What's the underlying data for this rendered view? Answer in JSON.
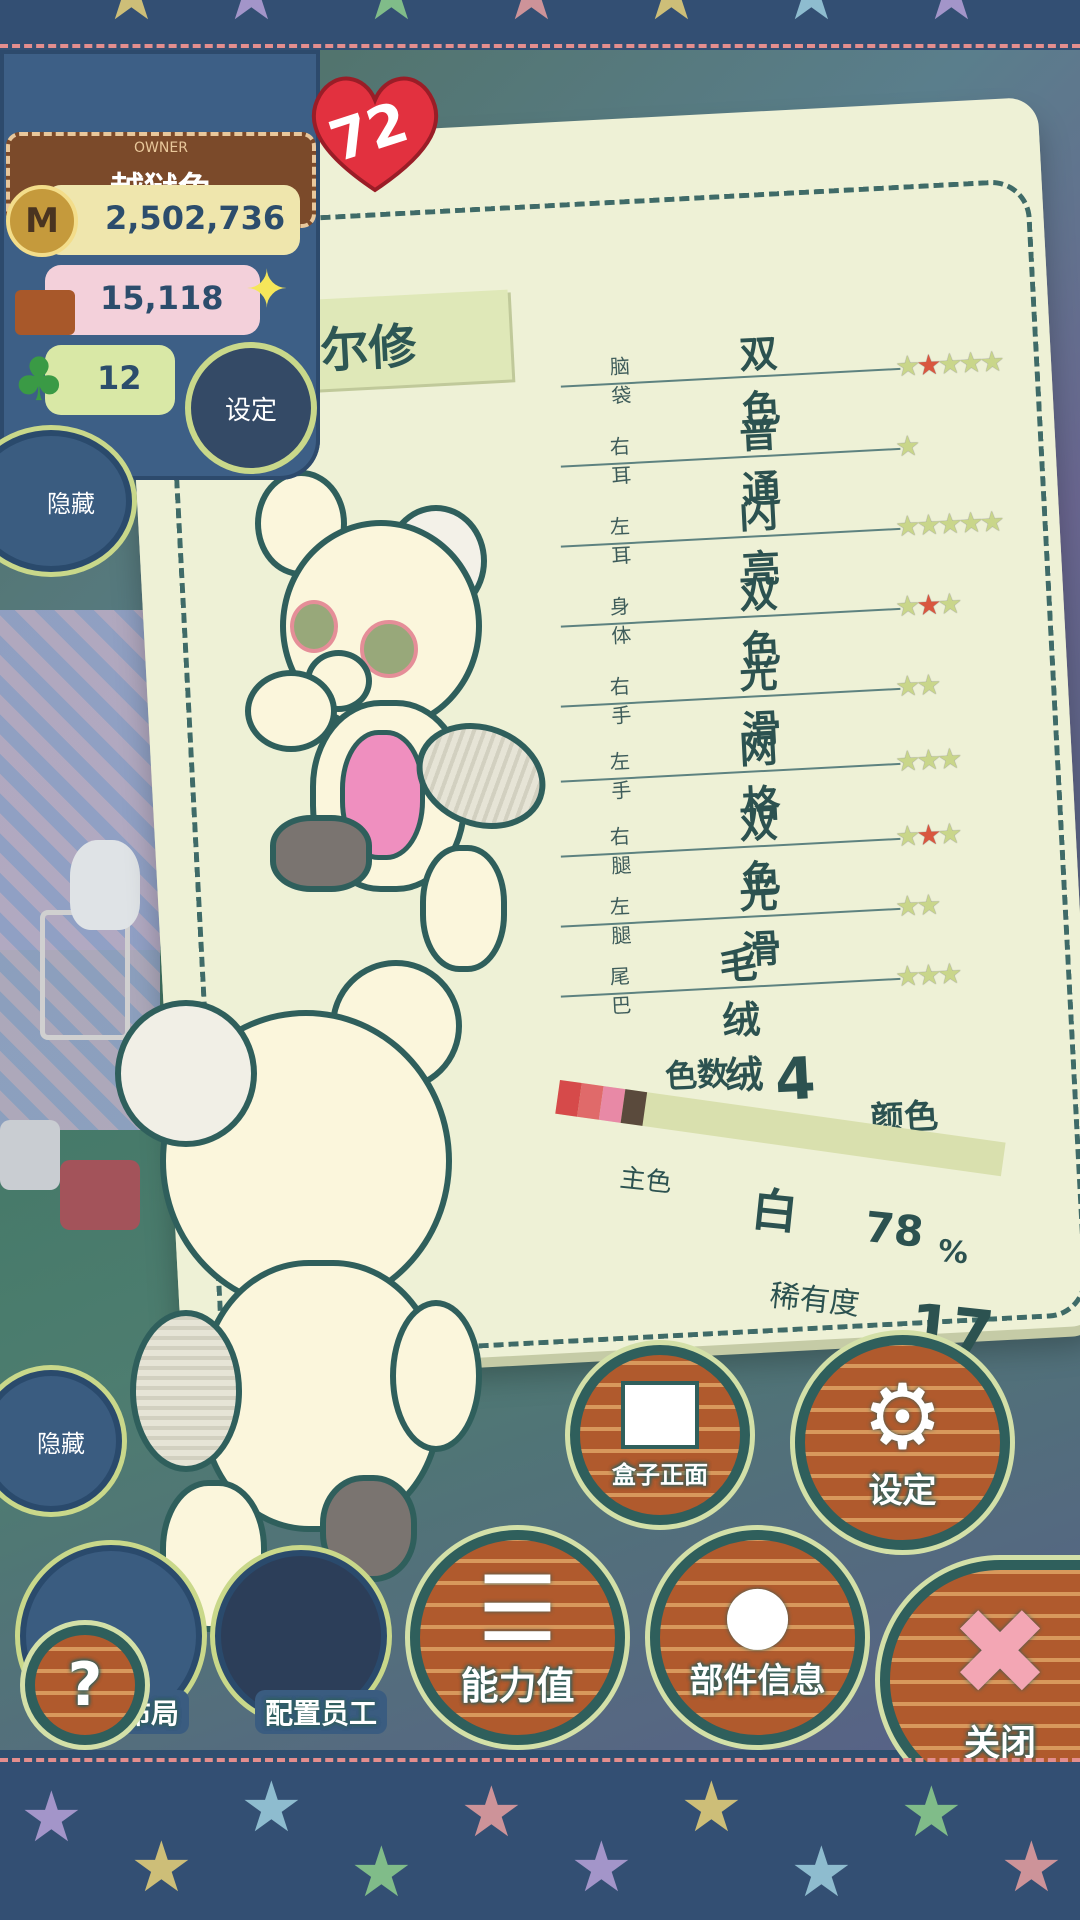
{
  "owner": {
    "caption": "OWNER",
    "name": "越狱兔",
    "money": "2,502,736",
    "money_icon": "M",
    "items": "15,118",
    "clover": "12",
    "settings_label": "设定"
  },
  "heart_level": "72",
  "hide_label": "隐藏",
  "bear_name": "尔修",
  "parts": [
    {
      "label": "脑袋",
      "value": "双色",
      "stars": 5,
      "highlight": 2
    },
    {
      "label": "右耳",
      "value": "普通",
      "stars": 1,
      "highlight": 0
    },
    {
      "label": "左耳",
      "value": "闪亮",
      "stars": 5,
      "highlight": 0
    },
    {
      "label": "身体",
      "value": "双色",
      "stars": 3,
      "highlight": 2
    },
    {
      "label": "右手",
      "value": "光滑",
      "stars": 2,
      "highlight": 0
    },
    {
      "label": "左手",
      "value": "网格",
      "stars": 3,
      "highlight": 0
    },
    {
      "label": "右腿",
      "value": "双色",
      "stars": 3,
      "highlight": 2
    },
    {
      "label": "左腿",
      "value": "光滑",
      "stars": 2,
      "highlight": 0
    },
    {
      "label": "尾巴",
      "value": "毛绒绒",
      "stars": 3,
      "highlight": 0
    }
  ],
  "colors": {
    "label": "色数",
    "count": "4",
    "unit": "颜色",
    "swatches": [
      "#d64a4a",
      "#e06a6a",
      "#e889a6",
      "#5a4a3c"
    ]
  },
  "main_color": {
    "label": "主色",
    "value": "白",
    "percent": "78",
    "percent_unit": "%"
  },
  "rarity": {
    "label": "稀有度",
    "value": "17"
  },
  "buttons": {
    "box_front": "盒子正面",
    "settings": "设定",
    "stats": "能力值",
    "parts_info": "部件信息",
    "close": "关闭",
    "layout": "改布局",
    "assign_staff": "配置员工",
    "help": "?"
  }
}
